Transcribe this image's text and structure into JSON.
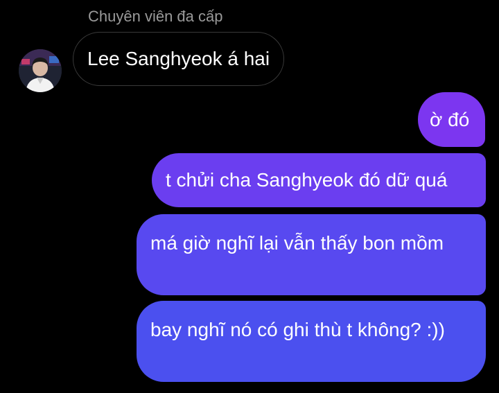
{
  "conversation": {
    "sender_name": "Chuyên viên đa cấp",
    "incoming_message": "Lee Sanghyeok á hai",
    "outgoing_messages": [
      "ờ đó",
      "t chửi cha Sanghyeok đó dữ quá",
      "má giờ nghĩ lại vẫn thấy bon mồm",
      "bay nghĩ nó có ghi thù t không? :))"
    ]
  },
  "colors": {
    "background": "#000000",
    "incoming_bubble_border": "#3a3a3a",
    "outgoing_gradient_top": "#7c36f0",
    "outgoing_gradient_bottom": "#4b50ef",
    "sender_name": "#9a9a9a"
  }
}
